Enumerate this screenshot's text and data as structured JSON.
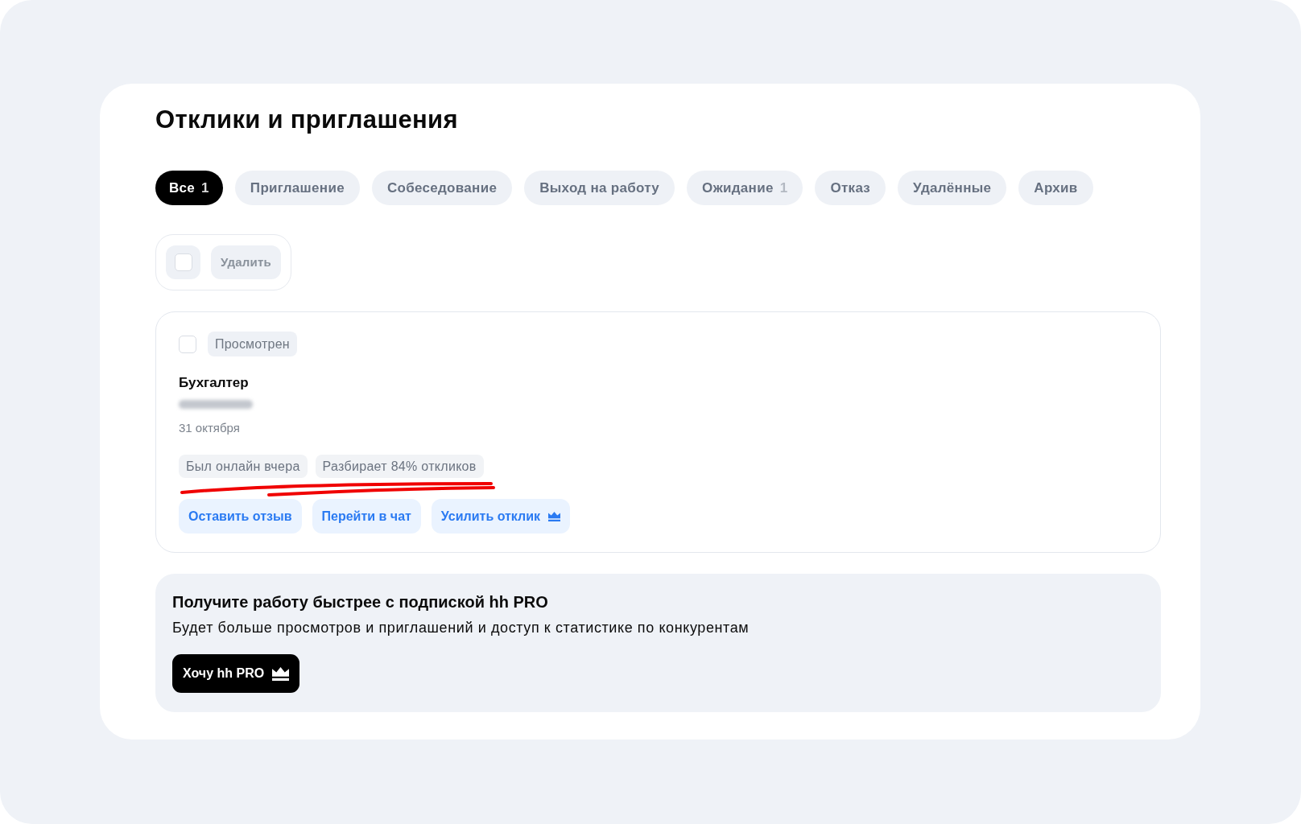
{
  "page": {
    "title": "Отклики и приглашения"
  },
  "tabs": [
    {
      "label": "Все",
      "count": "1",
      "selected": true
    },
    {
      "label": "Приглашение",
      "selected": false
    },
    {
      "label": "Собеседование",
      "selected": false
    },
    {
      "label": "Выход на работу",
      "selected": false
    },
    {
      "label": "Ожидание",
      "count": "1",
      "selected": false
    },
    {
      "label": "Отказ",
      "selected": false
    },
    {
      "label": "Удалённые",
      "selected": false
    },
    {
      "label": "Архив",
      "selected": false
    }
  ],
  "toolbar": {
    "select_all": {
      "checked": false
    },
    "delete_label": "Удалить"
  },
  "responses": [
    {
      "checked": false,
      "status": "Просмотрен",
      "position": "Бухгалтер",
      "employer": {
        "blurred": true
      },
      "date": "31 октября",
      "chips": [
        "Был онлайн вчера",
        "Разбирает 84% откликов"
      ],
      "annotation": {
        "kind": "scribble"
      },
      "actions": [
        {
          "label": "Оставить отзыв",
          "premium": false
        },
        {
          "label": "Перейти в чат",
          "premium": false
        },
        {
          "label": "Усилить отклик",
          "premium": true
        }
      ]
    }
  ],
  "promo": {
    "title": "Получите работу быстрее с подпиской hh PRO",
    "text": "Будет больше просмотров и приглашений и доступ к статистике по конкурентам",
    "button": {
      "label": "Хочу hh PRO",
      "premium": true
    }
  }
}
